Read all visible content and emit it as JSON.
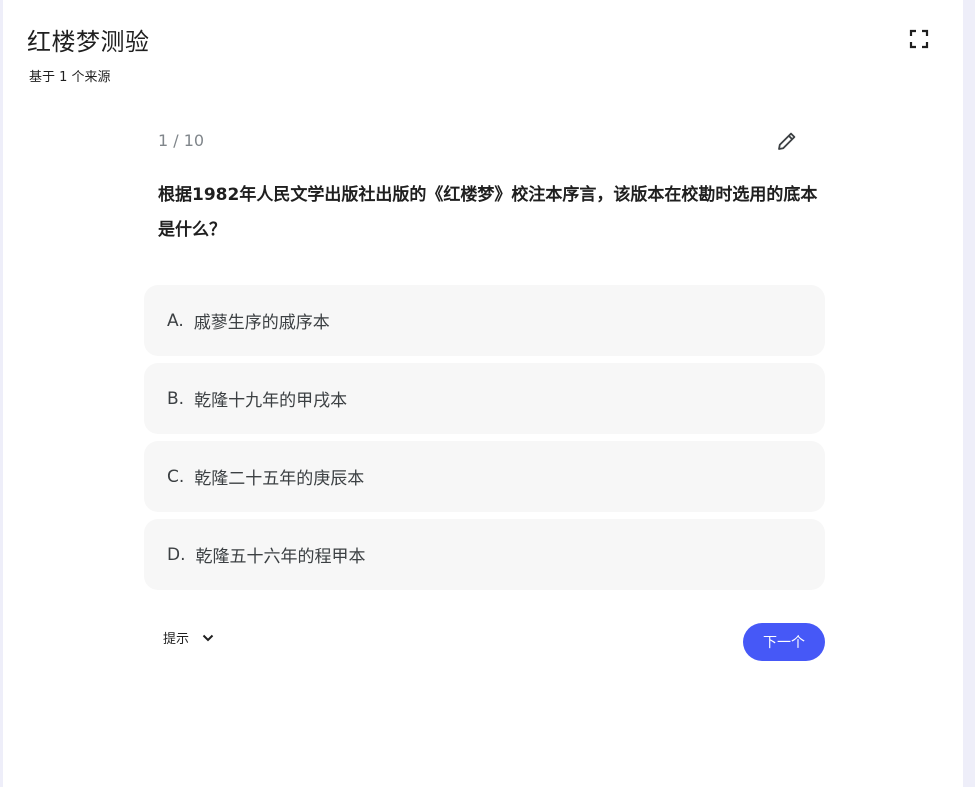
{
  "header": {
    "title": "红楼梦测验",
    "subtitle": "基于 1 个来源",
    "expand_icon": "expand-icon"
  },
  "quiz": {
    "counter": "1 / 10",
    "edit_icon": "pencil-icon",
    "question": "根据1982年人民文学出版社出版的《红楼梦》校注本序言，该版本在校勘时选用的底本是什么？",
    "options": [
      {
        "letter": "A.",
        "text": "戚蓼生序的戚序本"
      },
      {
        "letter": "B.",
        "text": "乾隆十九年的甲戌本"
      },
      {
        "letter": "C.",
        "text": "乾隆二十五年的庚辰本"
      },
      {
        "letter": "D.",
        "text": "乾隆五十六年的程甲本"
      }
    ]
  },
  "footer": {
    "hint_label": "提示",
    "hint_icon": "chevron-down-icon",
    "next_label": "下一个"
  },
  "colors": {
    "accent": "#4658f7",
    "option_bg": "#f7f7f7",
    "page_bg": "#eeeef9"
  }
}
